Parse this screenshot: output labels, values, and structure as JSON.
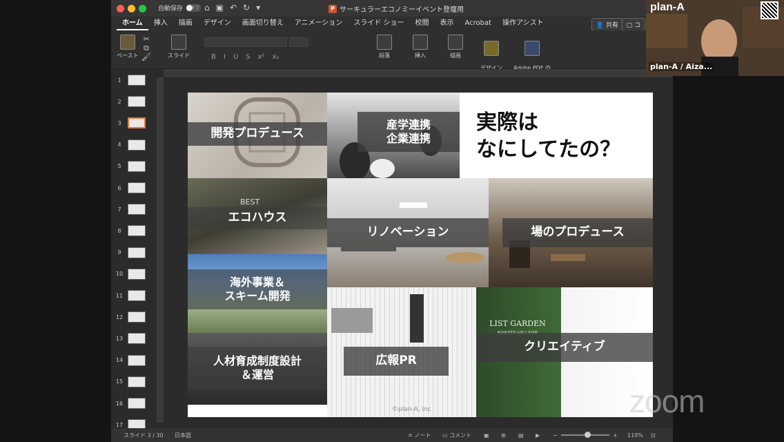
{
  "titlebar": {
    "autosave_label": "自動保存",
    "autosave_state": "オフ",
    "document_title": "サーキュラーエコノミーイベント登壇用",
    "ppt_badge": "P"
  },
  "ribbon_tabs": [
    "ホーム",
    "挿入",
    "描画",
    "デザイン",
    "画面切り替え",
    "アニメーション",
    "スライド ショー",
    "校閲",
    "表示",
    "Acrobat",
    "操作アシスト"
  ],
  "active_tab": "ホーム",
  "share_label": "共有",
  "comment_label": "コ",
  "ribbon_groups": {
    "paste": "ペースト",
    "slide": "スライド",
    "paragraph": "段落",
    "insert": "挿入",
    "draw": "描画",
    "designer": "デザイン\nアイデア",
    "adobe": "Adobe PDF の\n作成および共有"
  },
  "format_buttons": [
    "B",
    "I",
    "U",
    "S",
    "x²",
    "x₂"
  ],
  "thumbnails": [
    "1",
    "2",
    "3",
    "4",
    "5",
    "6",
    "7",
    "8",
    "9",
    "10",
    "11",
    "12",
    "13",
    "14",
    "15",
    "16",
    "17"
  ],
  "active_slide_index": 2,
  "slide": {
    "heading": "実際は\nなにしてたの？",
    "tiles": [
      {
        "label": "開発プロデュース"
      },
      {
        "label": "産学連携\n企業連携"
      },
      {
        "label": "エコハウス"
      },
      {
        "label": "リノベーション"
      },
      {
        "label": "場のプロデュース"
      },
      {
        "label": "海外事業＆\nスキーム開発"
      },
      {
        "label": "人材育成制度設計\n＆運営"
      },
      {
        "label": "広報PR"
      },
      {
        "label": "クリエイティブ"
      }
    ],
    "best_badge": "BEST",
    "list_garden": "LIST GARDEN",
    "list_garden_sub": "NAKATA-VILLAGE",
    "copyright": "©plan-A, inc"
  },
  "status": {
    "slide_counter": "スライド 3 / 30",
    "language": "日本語",
    "notes_label": "ノート",
    "comments_label": "コメント",
    "zoom_percent": "119%"
  },
  "video": {
    "brand": "plan-A",
    "participant": "plan-A / Aiza..."
  },
  "zoom_watermark": "zoom",
  "colors": {
    "active_thumb_border": "#e07a3a",
    "band": "#3c3c3c",
    "app_bg": "#2b2b2b"
  }
}
